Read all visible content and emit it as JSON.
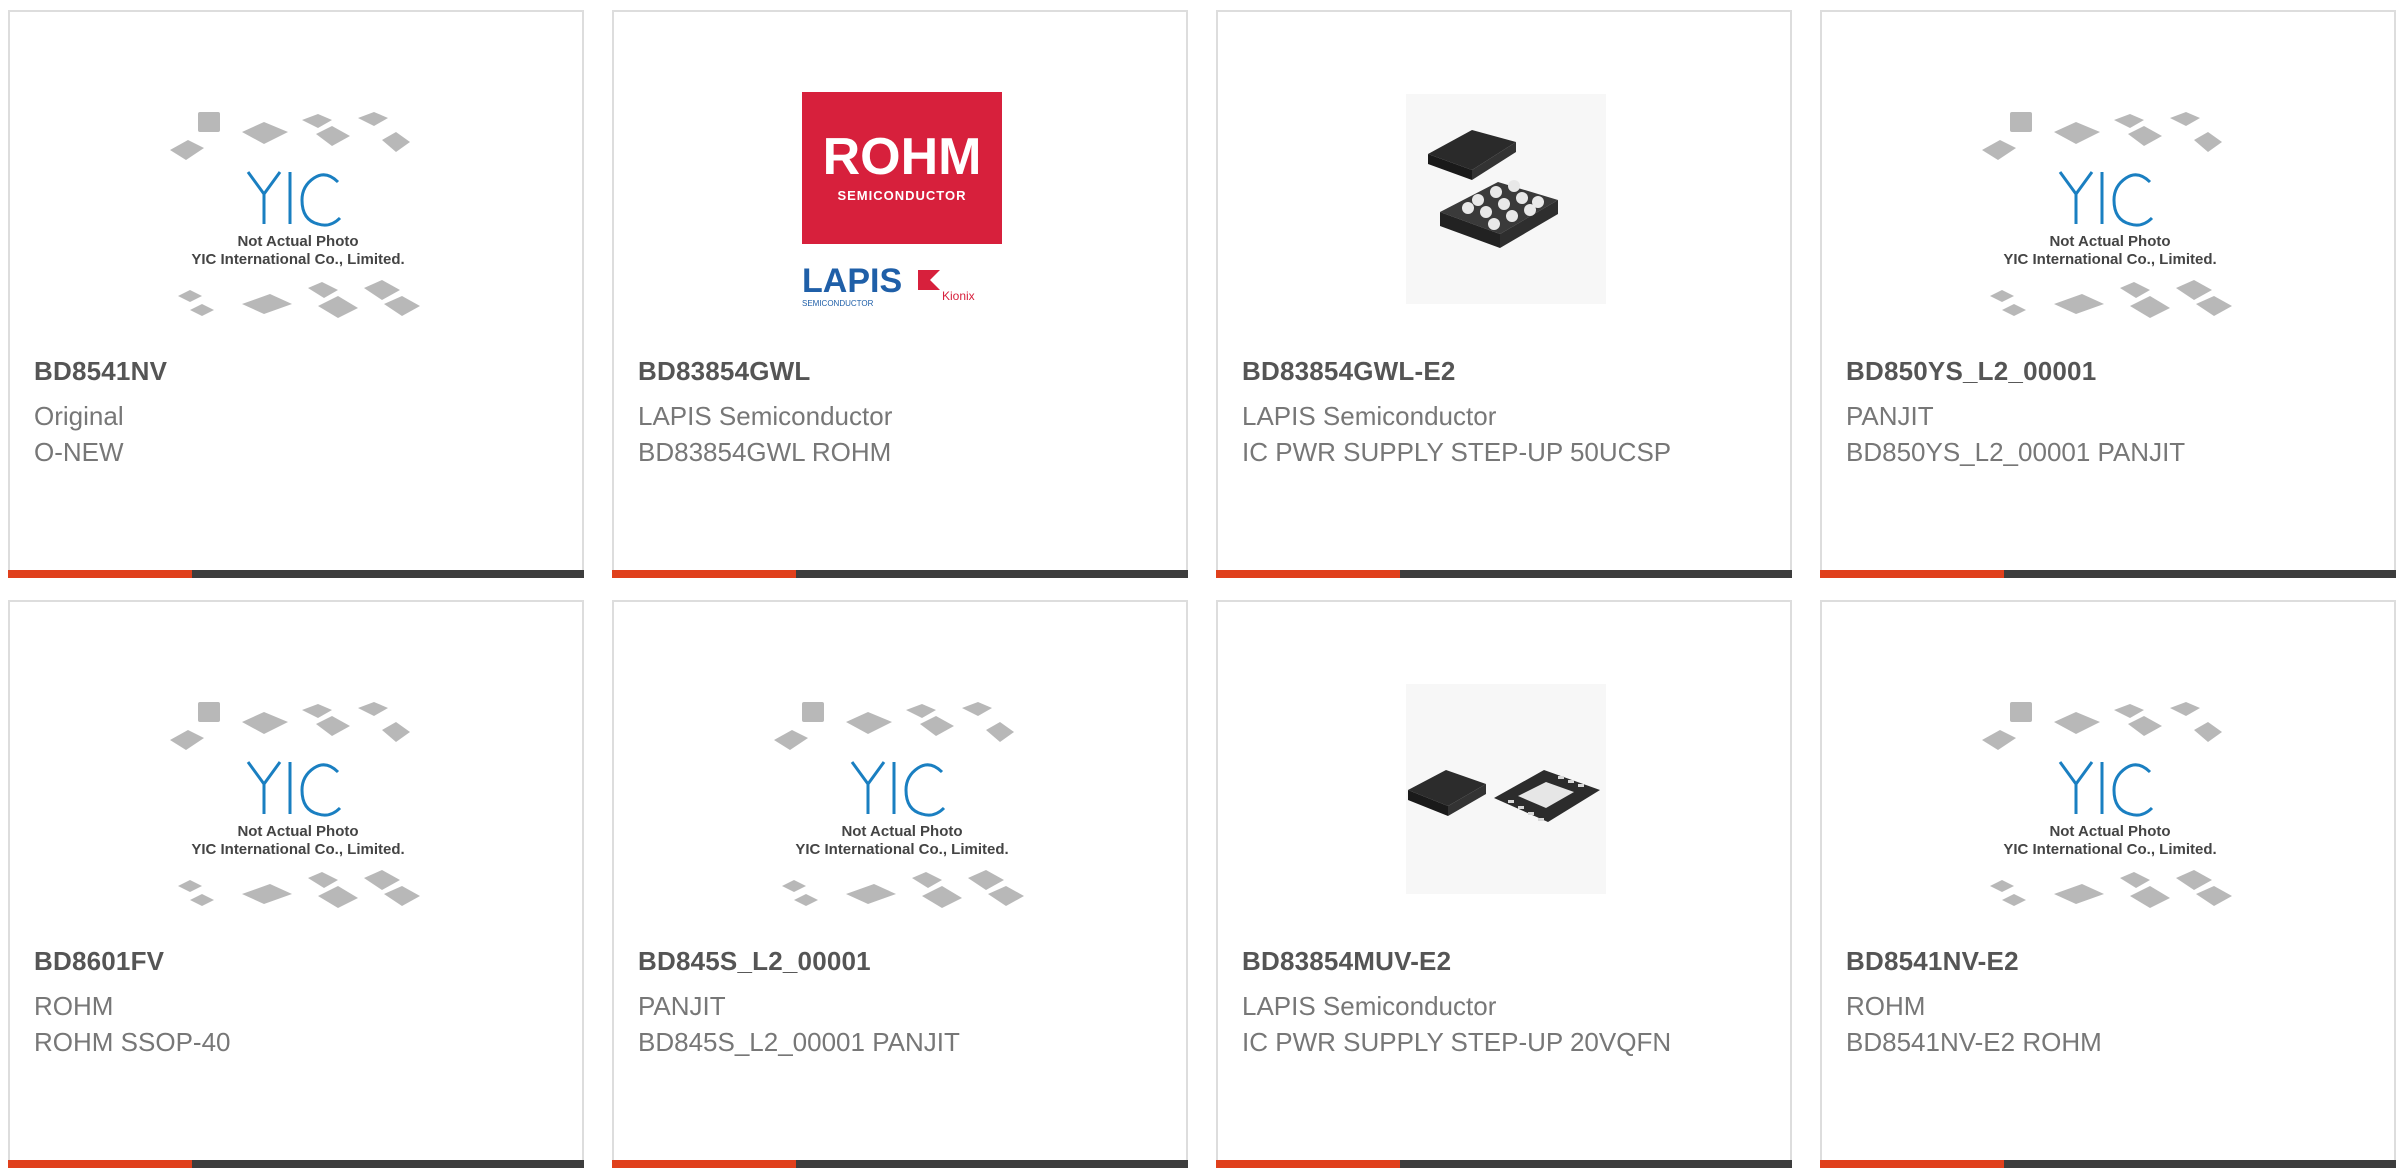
{
  "placeholder": {
    "brand": "YIC",
    "line1": "Not Actual Photo",
    "line2": "YIC International Co., Limited."
  },
  "rohm_logo": {
    "rohm": "ROHM",
    "semiconductor": "SEMICONDUCTOR",
    "lapis": "LAPIS",
    "lapis_sub": "SEMICONDUCTOR",
    "kionix": "Kionix"
  },
  "colors": {
    "accent": "#e0401c",
    "bar": "#3d3d3d",
    "border": "#dddddd",
    "title": "#555555",
    "text": "#777777",
    "rohm_red": "#d7203c",
    "lapis_blue": "#1f5fa8",
    "yic_blue": "#1a7fc1"
  },
  "products": [
    {
      "part": "BD8541NV",
      "lines": [
        "Original",
        "O-NEW"
      ],
      "image": "placeholder"
    },
    {
      "part": "BD83854GWL",
      "lines": [
        "LAPIS Semiconductor",
        "BD83854GWL ROHM"
      ],
      "image": "rohm-logo"
    },
    {
      "part": "BD83854GWL-E2",
      "lines": [
        "LAPIS Semiconductor",
        "IC PWR SUPPLY STEP-UP 50UCSP"
      ],
      "image": "chip-bga"
    },
    {
      "part": "BD850YS_L2_00001",
      "lines": [
        "PANJIT",
        "BD850YS_L2_00001 PANJIT"
      ],
      "image": "placeholder"
    },
    {
      "part": "BD8601FV",
      "lines": [
        "ROHM",
        "ROHM SSOP-40"
      ],
      "image": "placeholder"
    },
    {
      "part": "BD845S_L2_00001",
      "lines": [
        "PANJIT",
        "BD845S_L2_00001 PANJIT"
      ],
      "image": "placeholder"
    },
    {
      "part": "BD83854MUV-E2",
      "lines": [
        "LAPIS Semiconductor",
        "IC PWR SUPPLY STEP-UP 20VQFN"
      ],
      "image": "chip-qfn"
    },
    {
      "part": "BD8541NV-E2",
      "lines": [
        "ROHM",
        "BD8541NV-E2 ROHM"
      ],
      "image": "placeholder"
    }
  ]
}
